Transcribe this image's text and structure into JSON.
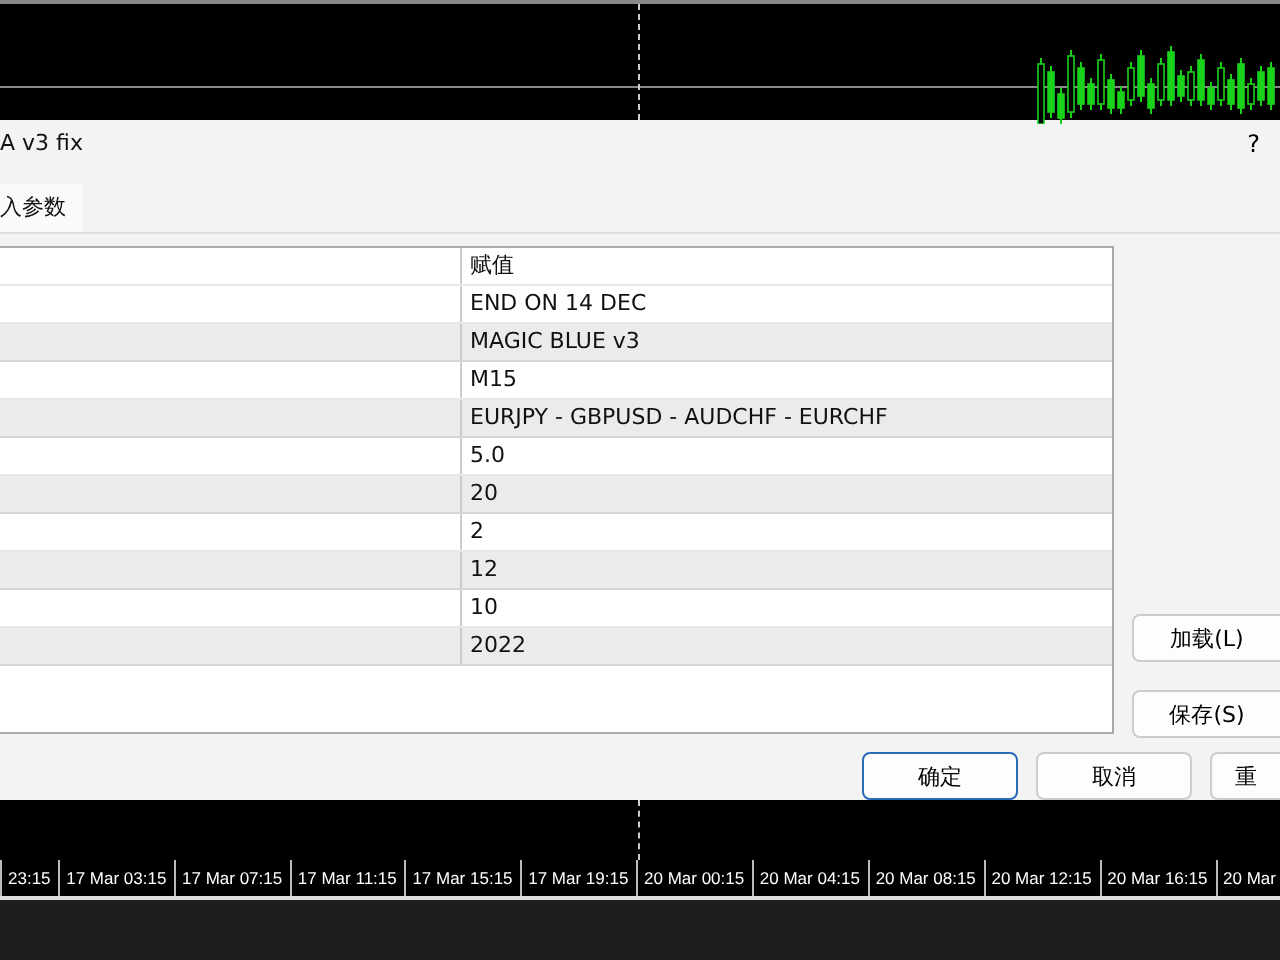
{
  "dialog": {
    "title": "A v3 fix",
    "help": "?"
  },
  "tabs": [
    {
      "label": "入参数",
      "selected": true
    }
  ],
  "table": {
    "header": "赋值",
    "rows": [
      {
        "value": "END ON 14 DEC"
      },
      {
        "value": "MAGIC BLUE v3"
      },
      {
        "value": "M15"
      },
      {
        "value": "EURJPY - GBPUSD - AUDCHF - EURCHF"
      },
      {
        "value": "5.0"
      },
      {
        "value": "20"
      },
      {
        "value": "2"
      },
      {
        "value": "12"
      },
      {
        "value": "10"
      },
      {
        "value": "2022"
      }
    ]
  },
  "side_buttons": [
    "加载(L)",
    "保存(S)"
  ],
  "buttons": [
    {
      "label": "确定",
      "focused": true
    },
    {
      "label": "取消",
      "focused": false
    },
    {
      "label": "重",
      "focused": false
    }
  ],
  "time_axis": [
    "23:15",
    "17 Mar 03:15",
    "17 Mar 07:15",
    "17 Mar 11:15",
    "17 Mar 15:15",
    "17 Mar 19:15",
    "20 Mar 00:15",
    "20 Mar 04:15",
    "20 Mar 08:15",
    "20 Mar 12:15",
    "20 Mar 16:15",
    "20 Mar"
  ]
}
